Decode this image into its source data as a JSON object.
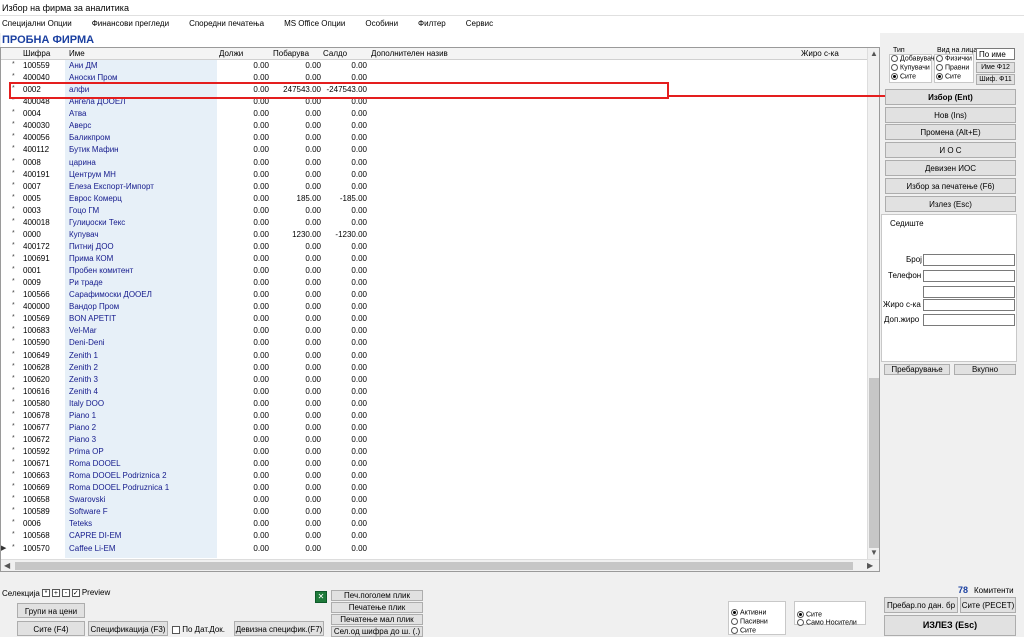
{
  "window": {
    "title": "Избор на фирма за аналитика"
  },
  "menu": [
    "Специјални Опции",
    "Финансови прегледи",
    "Споредни печатења",
    "MS Office Опции",
    "Особини",
    "Филтер",
    "Сервис"
  ],
  "company_title": "ПРОБНА ФИРМА",
  "grid": {
    "headers": {
      "code": "Шифра",
      "name": "Име",
      "dolzi": "Должи",
      "pobaruva": "Побарува",
      "saldo": "Салдо",
      "dop": "Дополнителен назив",
      "ziro": "Жиро с-ка"
    },
    "rows": [
      {
        "code": "100559",
        "name": "Ани ДМ",
        "d": "0.00",
        "p": "0.00",
        "s": "0.00"
      },
      {
        "code": "400040",
        "name": "Аноски Пром",
        "d": "0.00",
        "p": "0.00",
        "s": "0.00"
      },
      {
        "code": "0002",
        "name": "алфи",
        "d": "0.00",
        "p": "247543.00",
        "s": "-247543.00"
      },
      {
        "code": "400048",
        "name": "Ангела ДООЕЛ",
        "d": "0.00",
        "p": "0.00",
        "s": "0.00"
      },
      {
        "code": "0004",
        "name": "Атва",
        "d": "0.00",
        "p": "0.00",
        "s": "0.00"
      },
      {
        "code": "400030",
        "name": "Аверс",
        "d": "0.00",
        "p": "0.00",
        "s": "0.00"
      },
      {
        "code": "400056",
        "name": "Баликпром",
        "d": "0.00",
        "p": "0.00",
        "s": "0.00"
      },
      {
        "code": "400112",
        "name": "Бутик Мафин",
        "d": "0.00",
        "p": "0.00",
        "s": "0.00"
      },
      {
        "code": "0008",
        "name": "царина",
        "d": "0.00",
        "p": "0.00",
        "s": "0.00"
      },
      {
        "code": "400191",
        "name": "Центрум МН",
        "d": "0.00",
        "p": "0.00",
        "s": "0.00"
      },
      {
        "code": "0007",
        "name": "Елеза Експорт-Импорт",
        "d": "0.00",
        "p": "0.00",
        "s": "0.00"
      },
      {
        "code": "0005",
        "name": "Еврос Комерц",
        "d": "0.00",
        "p": "185.00",
        "s": "-185.00"
      },
      {
        "code": "0003",
        "name": "Гоцо ГМ",
        "d": "0.00",
        "p": "0.00",
        "s": "0.00"
      },
      {
        "code": "400018",
        "name": "Гулиџоски Текс",
        "d": "0.00",
        "p": "0.00",
        "s": "0.00"
      },
      {
        "code": "0000",
        "name": "Купувач",
        "d": "0.00",
        "p": "1230.00",
        "s": "-1230.00"
      },
      {
        "code": "400172",
        "name": "Питниј ДОО",
        "d": "0.00",
        "p": "0.00",
        "s": "0.00"
      },
      {
        "code": "100691",
        "name": "Прима КОМ",
        "d": "0.00",
        "p": "0.00",
        "s": "0.00"
      },
      {
        "code": "0001",
        "name": "Пробен комитент",
        "d": "0.00",
        "p": "0.00",
        "s": "0.00"
      },
      {
        "code": "0009",
        "name": "Ри траде",
        "d": "0.00",
        "p": "0.00",
        "s": "0.00"
      },
      {
        "code": "100566",
        "name": "Сарафимоски ДООЕЛ",
        "d": "0.00",
        "p": "0.00",
        "s": "0.00"
      },
      {
        "code": "400000",
        "name": "Вандор Пром",
        "d": "0.00",
        "p": "0.00",
        "s": "0.00"
      },
      {
        "code": "100569",
        "name": "BON APETIT",
        "d": "0.00",
        "p": "0.00",
        "s": "0.00"
      },
      {
        "code": "100683",
        "name": "Vel-Mar",
        "d": "0.00",
        "p": "0.00",
        "s": "0.00"
      },
      {
        "code": "100590",
        "name": "Deni-Deni",
        "d": "0.00",
        "p": "0.00",
        "s": "0.00"
      },
      {
        "code": "100649",
        "name": "Zenith 1",
        "d": "0.00",
        "p": "0.00",
        "s": "0.00"
      },
      {
        "code": "100628",
        "name": "Zenith 2",
        "d": "0.00",
        "p": "0.00",
        "s": "0.00"
      },
      {
        "code": "100620",
        "name": "Zenith 3",
        "d": "0.00",
        "p": "0.00",
        "s": "0.00"
      },
      {
        "code": "100616",
        "name": "Zenith 4",
        "d": "0.00",
        "p": "0.00",
        "s": "0.00"
      },
      {
        "code": "100580",
        "name": "Italy DOO",
        "d": "0.00",
        "p": "0.00",
        "s": "0.00"
      },
      {
        "code": "100678",
        "name": "Piano 1",
        "d": "0.00",
        "p": "0.00",
        "s": "0.00"
      },
      {
        "code": "100677",
        "name": "Piano 2",
        "d": "0.00",
        "p": "0.00",
        "s": "0.00"
      },
      {
        "code": "100672",
        "name": "Piano 3",
        "d": "0.00",
        "p": "0.00",
        "s": "0.00"
      },
      {
        "code": "100592",
        "name": "Prima OP",
        "d": "0.00",
        "p": "0.00",
        "s": "0.00"
      },
      {
        "code": "100671",
        "name": "Roma DOOEL",
        "d": "0.00",
        "p": "0.00",
        "s": "0.00"
      },
      {
        "code": "100663",
        "name": "Roma DOOEL Podriznica 2",
        "d": "0.00",
        "p": "0.00",
        "s": "0.00"
      },
      {
        "code": "100669",
        "name": "Roma DOOEL Podruznica 1",
        "d": "0.00",
        "p": "0.00",
        "s": "0.00"
      },
      {
        "code": "100658",
        "name": "Swarovski",
        "d": "0.00",
        "p": "0.00",
        "s": "0.00"
      },
      {
        "code": "100589",
        "name": "Software F",
        "d": "0.00",
        "p": "0.00",
        "s": "0.00"
      },
      {
        "code": "0006",
        "name": "Teteks",
        "d": "0.00",
        "p": "0.00",
        "s": "0.00"
      },
      {
        "code": "100568",
        "name": "CAPRE DI-EM",
        "d": "0.00",
        "p": "0.00",
        "s": "0.00"
      },
      {
        "code": "100570",
        "name": "Caffee Li-EM",
        "d": "0.00",
        "p": "0.00",
        "s": "0.00"
      }
    ]
  },
  "filters": {
    "tip_label": "Тип",
    "tip_options": [
      "Добавувач",
      "Купувачи",
      "Сите"
    ],
    "vid_label": "Вид на лица",
    "vid_options": [
      "Физички",
      "Правни",
      "Сите"
    ],
    "po_ime": "По име",
    "ime_btn": "Име Ф12",
    "shif_btn": "Шиф. Ф11"
  },
  "actions": [
    "Избор (Ent)",
    "Нов (Ins)",
    "Промена (Alt+E)",
    "И О С",
    "Девизен ИОС",
    "Избор за печатење (F6)",
    "Излез (Esc)"
  ],
  "info": {
    "sediste": "Седиште",
    "broj": "Број",
    "telefon": "Телефон",
    "ziro": "Жиро с-ка",
    "dop_ziro": "Доп.жиро"
  },
  "info_buttons": [
    "Пребарување",
    "Вкупно"
  ],
  "bottom": {
    "selection": "Селекција",
    "preview": "Preview",
    "group_prices": "Групи на цени",
    "all_f4": "Сите (F4)",
    "spec_f3": "Спецификација (F3)",
    "po_dat": "По Дат.Док.",
    "dev_spec": "Девизна специфик.(F7)",
    "print_buttons": [
      "Печ.поголем плик",
      "Печатење плик",
      "Печатење мал плик",
      "Сел.од шифра до ш. (.)"
    ],
    "status_options": [
      "Активни",
      "Пасивни",
      "Сите"
    ],
    "carrier_options": [
      "Сите",
      "Само Носители"
    ],
    "count": "78",
    "count_label": "Комитенти",
    "search_by_tax": "Пребар.по дан. бр",
    "all_reset": "Сите (РЕСЕТ)",
    "exit": "ИЗЛЕЗ  (Esc)"
  }
}
